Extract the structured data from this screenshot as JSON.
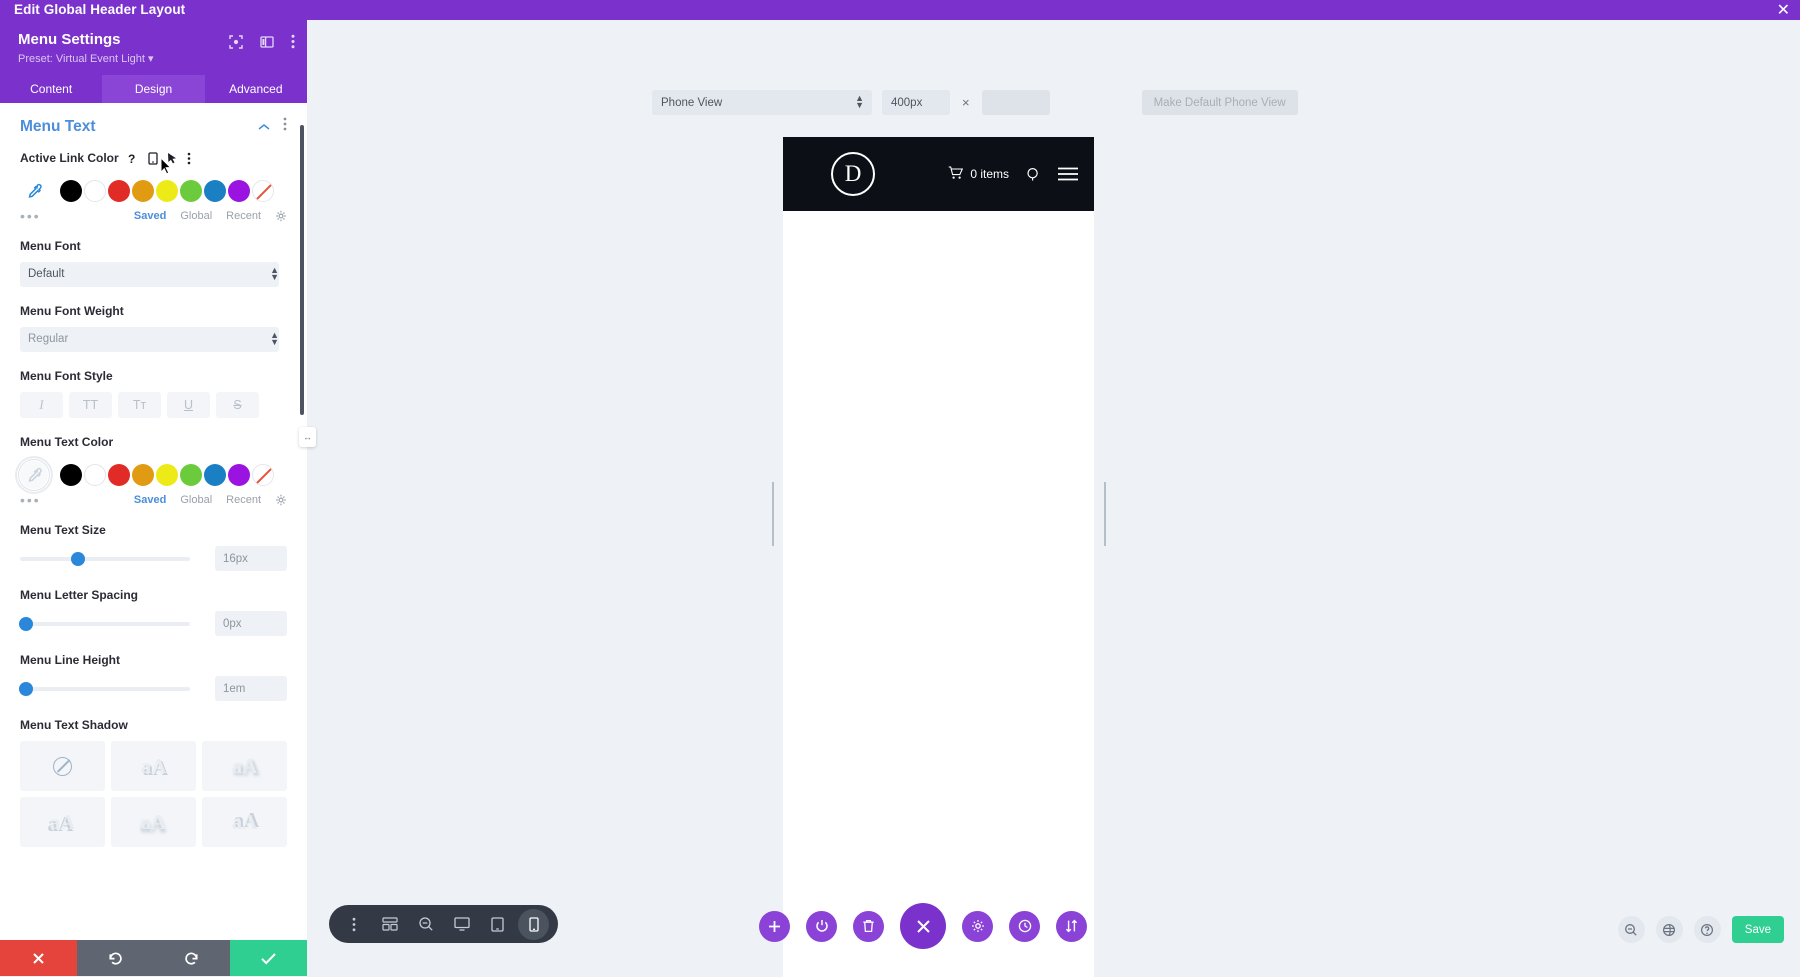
{
  "titlebar": {
    "title": "Edit Global Header Layout",
    "close_icon": "close-icon"
  },
  "panel": {
    "title": "Menu Settings",
    "preset": "Preset: Virtual Event Light ▾",
    "header_icons": [
      "target-icon",
      "layout-icon",
      "more-vertical-icon"
    ],
    "tabs": [
      {
        "label": "Content",
        "active": false
      },
      {
        "label": "Design",
        "active": true
      },
      {
        "label": "Advanced",
        "active": false
      }
    ],
    "section": {
      "title": "Menu Text",
      "collapse_icon": "chevron-up-icon",
      "more_icon": "more-vertical-icon"
    },
    "fields": {
      "active_link_color": {
        "label": "Active Link Color",
        "icons": [
          "help-icon",
          "mobile-icon",
          "hover-pointer-icon",
          "more-vertical-icon"
        ],
        "swatches": [
          "#000000",
          "#ffffff",
          "#e02b27",
          "#e09b12",
          "#edeb17",
          "#6ccb3c",
          "#1b7fc4",
          "#9b13e0",
          "none"
        ],
        "eyedropper": "eyedropper-icon",
        "dots": "•••",
        "tabs": [
          {
            "label": "Saved",
            "active": true
          },
          {
            "label": "Global",
            "active": false
          },
          {
            "label": "Recent",
            "active": false
          }
        ],
        "gear": "gear-icon"
      },
      "menu_font": {
        "label": "Menu Font",
        "value": "Default"
      },
      "menu_font_weight": {
        "label": "Menu Font Weight",
        "value": "Regular"
      },
      "menu_font_style": {
        "label": "Menu Font Style",
        "buttons": [
          "I",
          "TT",
          "Tᴛ",
          "U",
          "S"
        ],
        "names": [
          "italic",
          "uppercase",
          "capitalize",
          "underline",
          "strikethrough"
        ]
      },
      "menu_text_color": {
        "label": "Menu Text Color",
        "swatches": [
          "#000000",
          "#ffffff",
          "#e02b27",
          "#e09b12",
          "#edeb17",
          "#6ccb3c",
          "#1b7fc4",
          "#9b13e0",
          "none"
        ],
        "eyedropper": "eyedropper-icon",
        "eyedropper_selected": true,
        "dots": "•••",
        "tabs": [
          {
            "label": "Saved",
            "active": true
          },
          {
            "label": "Global",
            "active": false
          },
          {
            "label": "Recent",
            "active": false
          }
        ],
        "gear": "gear-icon"
      },
      "menu_text_size": {
        "label": "Menu Text Size",
        "value": "16px",
        "slider_percent": 34
      },
      "menu_letter_spacing": {
        "label": "Menu Letter Spacing",
        "value": "0px",
        "slider_percent": 0
      },
      "menu_line_height": {
        "label": "Menu Line Height",
        "value": "1em",
        "slider_percent": 0
      },
      "menu_text_shadow": {
        "label": "Menu Text Shadow",
        "options": [
          "none",
          "shadow-1",
          "shadow-2",
          "shadow-3",
          "shadow-4",
          "shadow-5"
        ],
        "glyph": "aA"
      }
    },
    "actions": [
      {
        "name": "cancel",
        "icon": "x-icon",
        "color": "#e5443c"
      },
      {
        "name": "undo",
        "icon": "undo-icon",
        "color": "#5f6672"
      },
      {
        "name": "redo",
        "icon": "redo-icon",
        "color": "#5f6672"
      },
      {
        "name": "save",
        "icon": "check-icon",
        "color": "#2ecf91"
      }
    ],
    "resize_handle": "↔"
  },
  "canvas": {
    "view_toolbar": {
      "view_select": {
        "value": "Phone View",
        "options": [
          "Phone View",
          "Tablet View",
          "Desktop View"
        ]
      },
      "width_value": "400px",
      "clear_icon": "×",
      "height_value": "",
      "make_default_label": "Make Default Phone View"
    },
    "preview": {
      "logo_letter": "D",
      "logo_name": "divi-logo",
      "cart_count": "0 items",
      "cart_icon": "shopping-cart-icon",
      "search_icon": "search-icon",
      "hamburger_icon": "hamburger-menu-icon"
    },
    "mini_toolbar": [
      {
        "name": "more-options",
        "icon": "more-vertical-icon",
        "active": false
      },
      {
        "name": "wireframe-view",
        "icon": "wireframe-icon",
        "active": false
      },
      {
        "name": "zoom-view",
        "icon": "zoom-out-icon",
        "active": false
      },
      {
        "name": "desktop-view",
        "icon": "desktop-icon",
        "active": false
      },
      {
        "name": "tablet-view",
        "icon": "tablet-icon",
        "active": false
      },
      {
        "name": "phone-view",
        "icon": "phone-icon",
        "active": true
      }
    ],
    "circle_toolbar": [
      {
        "name": "add-section",
        "icon": "plus-icon",
        "big": false
      },
      {
        "name": "toggle-builder",
        "icon": "power-icon",
        "big": false
      },
      {
        "name": "delete-layout",
        "icon": "trash-icon",
        "big": false
      },
      {
        "name": "close-builder",
        "icon": "x-icon",
        "big": true
      },
      {
        "name": "builder-settings",
        "icon": "gear-icon",
        "big": false
      },
      {
        "name": "history",
        "icon": "clock-icon",
        "big": false
      },
      {
        "name": "reorder",
        "icon": "sort-icon",
        "big": false
      }
    ],
    "right_controls": [
      {
        "name": "zoom-out",
        "icon": "zoom-out-icon"
      },
      {
        "name": "layers",
        "icon": "layers-icon"
      },
      {
        "name": "help",
        "icon": "help-icon"
      }
    ],
    "save_label": "Save"
  },
  "colors": {
    "brand_purple": "#7b32cc",
    "accent_blue": "#4c8ed9",
    "slider_blue": "#2b87da",
    "save_green": "#2ecf91",
    "cancel_red": "#e5443c",
    "panel_bg": "#ffffff",
    "canvas_bg": "#eef1f5",
    "preview_header_bg": "#0c1016"
  }
}
